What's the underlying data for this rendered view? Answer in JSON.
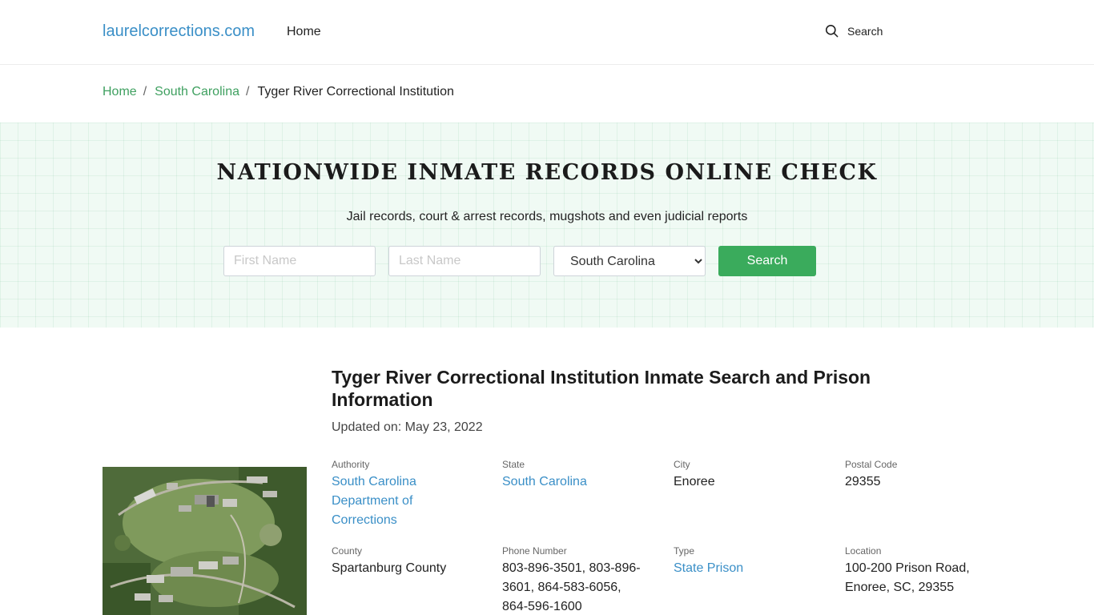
{
  "header": {
    "brand": "laurelcorrections.com",
    "nav_home": "Home",
    "search_label": "Search"
  },
  "breadcrumb": {
    "home": "Home",
    "state": "South Carolina",
    "current": "Tyger River Correctional Institution"
  },
  "hero": {
    "title": "NATIONWIDE INMATE RECORDS ONLINE CHECK",
    "subtitle": "Jail records, court & arrest records, mugshots and even judicial reports",
    "first_name_placeholder": "First Name",
    "last_name_placeholder": "Last Name",
    "state_selected": "South Carolina",
    "search_button": "Search"
  },
  "facility": {
    "title": "Tyger River Correctional Institution Inmate Search and Prison Information",
    "updated_label": "Updated on:",
    "updated_date": "May 23, 2022",
    "authority_label": "Authority",
    "authority_value": "South Carolina Department of Corrections",
    "state_label": "State",
    "state_value": "South Carolina",
    "city_label": "City",
    "city_value": "Enoree",
    "postal_label": "Postal Code",
    "postal_value": "29355",
    "county_label": "County",
    "county_value": "Spartanburg County",
    "phone_label": "Phone Number",
    "phone_value": "803-896-3501, 803-896-3601, 864-583-6056, 864-596-1600",
    "type_label": "Type",
    "type_value": "State Prison",
    "location_label": "Location",
    "location_value": "100-200 Prison Road, Enoree, SC, 29355"
  },
  "colors": {
    "brand_blue": "#3a8fc7",
    "breadcrumb_green": "#3fa060",
    "button_green": "#3aab5c",
    "hero_bg": "#f0faf4"
  },
  "icons": {
    "search": "search-icon"
  }
}
